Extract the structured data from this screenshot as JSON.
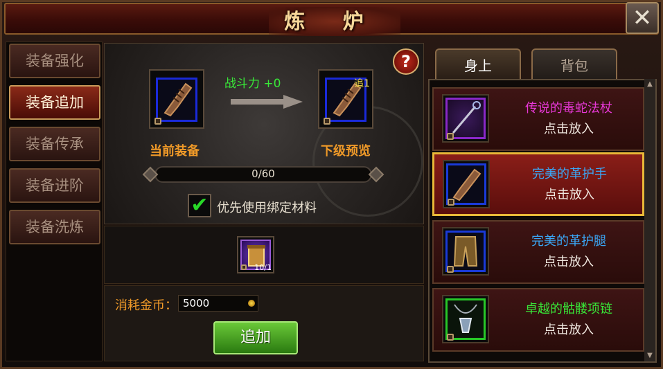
{
  "window": {
    "title": "炼 炉",
    "close_label": "✕"
  },
  "nav": {
    "items": [
      {
        "label": "装备强化",
        "active": false
      },
      {
        "label": "装备追加",
        "active": true
      },
      {
        "label": "装备传承",
        "active": false
      },
      {
        "label": "装备进阶",
        "active": false
      },
      {
        "label": "装备洗炼",
        "active": false
      }
    ]
  },
  "forge": {
    "help_label": "?",
    "power_change": "战斗力 +0",
    "current_label": "当前装备",
    "preview_label": "下级预览",
    "preview_tag": "追1",
    "progress_text": "0/60",
    "progress_value": 0,
    "progress_max": 60,
    "bind_checked": true,
    "bind_label": "优先使用绑定材料",
    "material_count": "10/1",
    "cost_label": "消耗金币：",
    "cost_value": "5000",
    "add_button": "追加"
  },
  "tabs": {
    "on_body": "身上",
    "bag": "背包"
  },
  "equipment_list": [
    {
      "name": "传说的毒蛇法杖",
      "hint": "点击放入",
      "name_color": "#e838d8",
      "ring_color": "#8a28c8",
      "icon": "staff-icon",
      "selected": false
    },
    {
      "name": "完美的革护手",
      "hint": "点击放入",
      "name_color": "#3aa8f8",
      "ring_color": "#1a3ad8",
      "icon": "gauntlet-icon",
      "selected": true
    },
    {
      "name": "完美的革护腿",
      "hint": "点击放入",
      "name_color": "#3aa8f8",
      "ring_color": "#1a3ad8",
      "icon": "leggings-icon",
      "selected": false
    },
    {
      "name": "卓越的骷髅项链",
      "hint": "点击放入",
      "name_color": "#38e838",
      "ring_color": "#28c828",
      "icon": "necklace-icon",
      "selected": false
    }
  ]
}
